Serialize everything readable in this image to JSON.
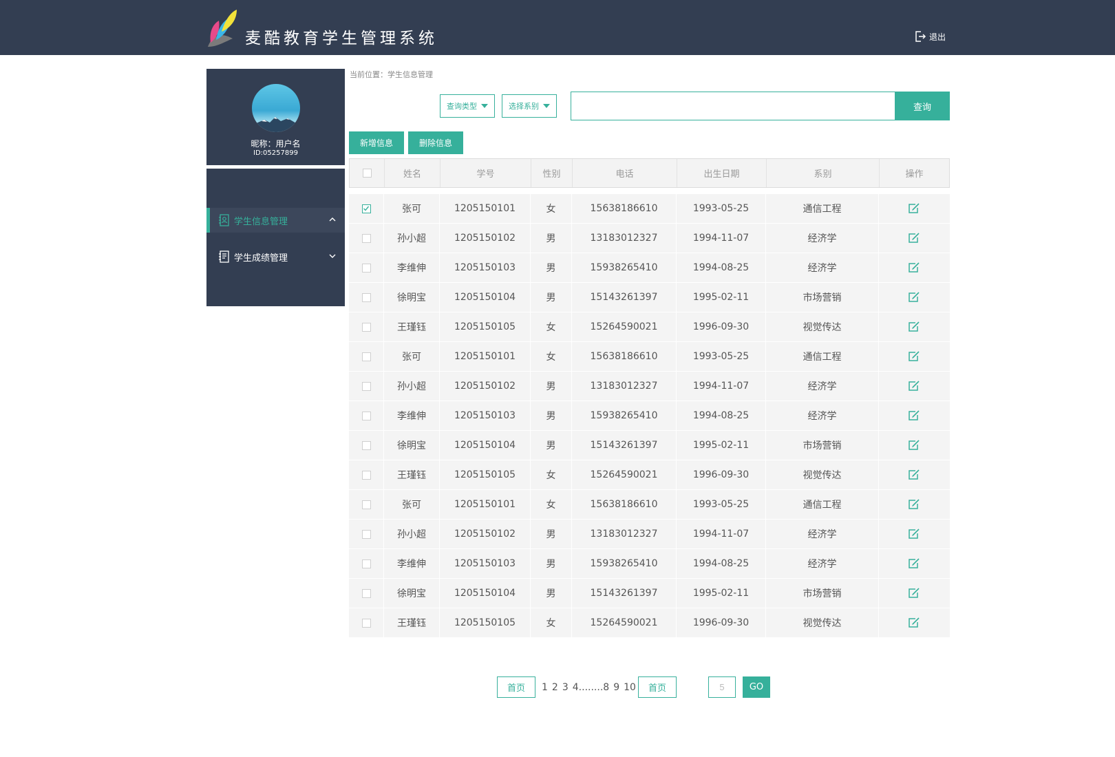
{
  "header": {
    "title": "麦酷教育学生管理系统",
    "logout_label": "退出"
  },
  "profile": {
    "nickname": "昵称：用户名",
    "id": "ID:05257899"
  },
  "sidebar": {
    "items": [
      {
        "label": "学生信息管理",
        "active": true,
        "icon": "contact-book-icon"
      },
      {
        "label": "学生成绩管理",
        "active": false,
        "icon": "report-icon"
      }
    ]
  },
  "breadcrumb": "当前位置：学生信息管理",
  "filters": {
    "query_type": "查询类型",
    "department": "选择系别",
    "search_value": "",
    "search_button": "查询"
  },
  "actions": {
    "add": "新增信息",
    "delete": "删除信息"
  },
  "table": {
    "headers": [
      "姓名",
      "学号",
      "性别",
      "电话",
      "出生日期",
      "系别",
      "操作"
    ],
    "rows": [
      {
        "checked": true,
        "name": "张可",
        "id": "1205150101",
        "gender": "女",
        "phone": "15638186610",
        "birth": "1993-05-25",
        "dept": "通信工程"
      },
      {
        "checked": false,
        "name": "孙小超",
        "id": "1205150102",
        "gender": "男",
        "phone": "13183012327",
        "birth": "1994-11-07",
        "dept": "经济学"
      },
      {
        "checked": false,
        "name": "李维伸",
        "id": "1205150103",
        "gender": "男",
        "phone": "15938265410",
        "birth": "1994-08-25",
        "dept": "经济学"
      },
      {
        "checked": false,
        "name": "徐明宝",
        "id": "1205150104",
        "gender": "男",
        "phone": "15143261397",
        "birth": "1995-02-11",
        "dept": "市场营销"
      },
      {
        "checked": false,
        "name": "王瑾钰",
        "id": "1205150105",
        "gender": "女",
        "phone": "15264590021",
        "birth": "1996-09-30",
        "dept": "视觉传达"
      },
      {
        "checked": false,
        "name": "张可",
        "id": "1205150101",
        "gender": "女",
        "phone": "15638186610",
        "birth": "1993-05-25",
        "dept": "通信工程"
      },
      {
        "checked": false,
        "name": "孙小超",
        "id": "1205150102",
        "gender": "男",
        "phone": "13183012327",
        "birth": "1994-11-07",
        "dept": "经济学"
      },
      {
        "checked": false,
        "name": "李维伸",
        "id": "1205150103",
        "gender": "男",
        "phone": "15938265410",
        "birth": "1994-08-25",
        "dept": "经济学"
      },
      {
        "checked": false,
        "name": "徐明宝",
        "id": "1205150104",
        "gender": "男",
        "phone": "15143261397",
        "birth": "1995-02-11",
        "dept": "市场营销"
      },
      {
        "checked": false,
        "name": "王瑾钰",
        "id": "1205150105",
        "gender": "女",
        "phone": "15264590021",
        "birth": "1996-09-30",
        "dept": "视觉传达"
      },
      {
        "checked": false,
        "name": "张可",
        "id": "1205150101",
        "gender": "女",
        "phone": "15638186610",
        "birth": "1993-05-25",
        "dept": "通信工程"
      },
      {
        "checked": false,
        "name": "孙小超",
        "id": "1205150102",
        "gender": "男",
        "phone": "13183012327",
        "birth": "1994-11-07",
        "dept": "经济学"
      },
      {
        "checked": false,
        "name": "李维伸",
        "id": "1205150103",
        "gender": "男",
        "phone": "15938265410",
        "birth": "1994-08-25",
        "dept": "经济学"
      },
      {
        "checked": false,
        "name": "徐明宝",
        "id": "1205150104",
        "gender": "男",
        "phone": "15143261397",
        "birth": "1995-02-11",
        "dept": "市场营销"
      },
      {
        "checked": false,
        "name": "王瑾钰",
        "id": "1205150105",
        "gender": "女",
        "phone": "15264590021",
        "birth": "1996-09-30",
        "dept": "视觉传达"
      }
    ]
  },
  "pagination": {
    "first_label": "首页",
    "pages": [
      "1",
      "2",
      "3",
      "4........8",
      "9",
      "10"
    ],
    "last_label": "首页",
    "jump_value": "5",
    "go_label": "GO"
  },
  "colors": {
    "accent": "#36b09b",
    "header_bg": "#333e52",
    "row_bg": "#f4f4f4"
  }
}
